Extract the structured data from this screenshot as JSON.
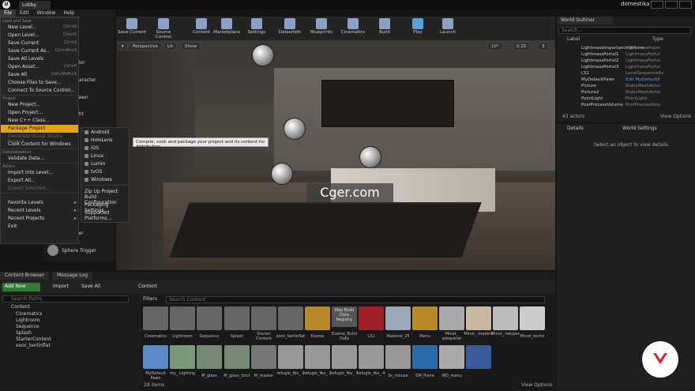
{
  "titlebar": {
    "tab": "Lobby",
    "brand": "domestika"
  },
  "menubar": [
    "File",
    "Edit",
    "Window",
    "Help"
  ],
  "file_menu": {
    "sections": [
      {
        "title": "Load and Save",
        "items": [
          {
            "label": "New Level...",
            "shortcut": "Ctrl+N"
          },
          {
            "label": "Open Level...",
            "shortcut": "Ctrl+O"
          },
          {
            "label": "Save Current",
            "shortcut": "Ctrl+S"
          },
          {
            "label": "Save Current As...",
            "shortcut": "Ctrl+Alt+S"
          },
          {
            "label": "Save All Levels",
            "shortcut": ""
          },
          {
            "label": "Open Asset...",
            "shortcut": "Ctrl+P"
          },
          {
            "label": "Save All",
            "shortcut": "Ctrl+Shift+S"
          },
          {
            "label": "Choose Files to Save...",
            "shortcut": ""
          },
          {
            "label": "Connect To Source Control...",
            "shortcut": ""
          }
        ]
      },
      {
        "title": "Project",
        "items": [
          {
            "label": "New Project...",
            "shortcut": ""
          },
          {
            "label": "Open Project...",
            "shortcut": ""
          },
          {
            "label": "New C++ Class...",
            "shortcut": ""
          },
          {
            "label": "Package Project",
            "shortcut": ""
          },
          {
            "label": "Generate Visual Studio Project",
            "shortcut": ""
          },
          {
            "label": "Cook Content for Windows",
            "shortcut": ""
          }
        ]
      },
      {
        "title": "DataValidation",
        "items": [
          {
            "label": "Validate Data...",
            "shortcut": ""
          }
        ]
      },
      {
        "title": "Actors",
        "items": [
          {
            "label": "Import Into Level...",
            "shortcut": ""
          },
          {
            "label": "Export All...",
            "shortcut": ""
          },
          {
            "label": "Export Selected...",
            "shortcut": ""
          }
        ]
      },
      {
        "title": "",
        "items": [
          {
            "label": "Favorite Levels",
            "shortcut": ""
          },
          {
            "label": "Recent Levels",
            "shortcut": ""
          },
          {
            "label": "Recent Projects",
            "shortcut": ""
          },
          {
            "label": "Exit",
            "shortcut": ""
          }
        ]
      }
    ]
  },
  "package_submenu": [
    "Android",
    "HoloLens",
    "iOS",
    "Linux",
    "Lumin",
    "tvOS",
    "Windows",
    "Zip Up Project",
    "Build Configuration",
    "Packaging Settings...",
    "Supported Platforms..."
  ],
  "tooltip": "Compile, cook and package your project and its content for distribution.",
  "place_panel": [
    "Actor",
    "Character",
    "Pawn",
    "ght",
    "gger",
    "Sphere Trigger"
  ],
  "toolbar": [
    "Save Current",
    "Source Control",
    "Content",
    "Marketplace",
    "Settings",
    "Datasmith",
    "Blueprints",
    "Cinematics",
    "Build",
    "Play",
    "Launch"
  ],
  "viewport": {
    "perspective": "Perspective",
    "lit": "Lit",
    "show": "Show",
    "fov": "10°",
    "speed": "0.25",
    "cam": "3"
  },
  "watermark": "Cger.com",
  "outliner": {
    "tab": "World Outliner",
    "search_placeholder": "Search...",
    "col_label": "Label",
    "col_type": "Type",
    "rows": [
      {
        "name": "LightmassImportanceVolume",
        "type": "LightmassImpor"
      },
      {
        "name": "LightmassPortal1",
        "type": "LightmassPortal"
      },
      {
        "name": "LightmassPortal2",
        "type": "LightmassPortal"
      },
      {
        "name": "LightmassPortal3",
        "type": "LightmassPortal"
      },
      {
        "name": "LS1",
        "type": "LevelSequenceAc"
      },
      {
        "name": "MyDefaultPawn",
        "type": "Edit MyDefaultP"
      },
      {
        "name": "Picture",
        "type": "StaticMeshActor"
      },
      {
        "name": "Picture2",
        "type": "StaticMeshActor"
      },
      {
        "name": "PointLight",
        "type": "PointLight"
      },
      {
        "name": "PostProcessVolume",
        "type": "PostProcessVolu"
      }
    ],
    "count": "43 actors",
    "view_options": "View Options"
  },
  "details": {
    "tab": "Details",
    "tab2": "World Settings",
    "empty": "Select an object to view details."
  },
  "content_browser": {
    "tab": "Content Browser",
    "tab2": "Message Log",
    "add_new": "Add New",
    "import": "Import",
    "save_all": "Save All",
    "path": "Content",
    "search_paths": "Search Paths",
    "filters": "Filters",
    "search_content": "Search Content",
    "folders": [
      "Content",
      "Cinematics",
      "Lightroom",
      "Sequence",
      "Splash",
      "StarterContent",
      "exoc_berlinflat"
    ],
    "assets_row1": [
      "Cinematics",
      "Lightroom",
      "Sequence",
      "Splash",
      "Starter Content",
      "exoc_berlinflat",
      "Exoma",
      "Exoma_Build Data",
      "LS1",
      "Material_25",
      "Menu",
      "Minot_ adsquinet",
      "Minot_ madera",
      "Minot_ relupes",
      "Minot_techo"
    ],
    "assets_row2": [
      "MyDefault Pawn",
      "my_ Lighting",
      "M_glass",
      "M_glass_tinct",
      "M_master",
      "refugio_fbx_ 1",
      "refugio_fbx_ 2",
      "refugio_fbx_ 3",
      "refugio_fbx_ 4",
      "Sc_mouse",
      "SM_Plane",
      "WD_menu"
    ],
    "registry": "Map Build Data Registry",
    "count": "28 items",
    "view_options": "View Options"
  }
}
